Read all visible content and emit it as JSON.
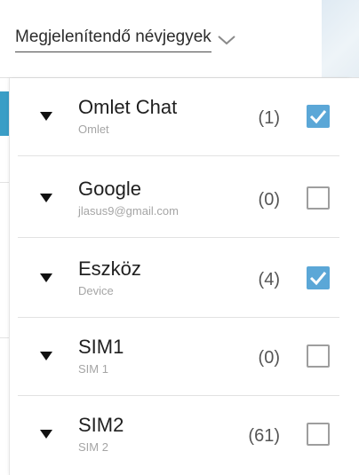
{
  "header": {
    "dropdown_label": "Megjelenítendő névjegyek"
  },
  "accounts": [
    {
      "name": "Omlet Chat",
      "subtitle": "Omlet",
      "count": "(1)",
      "checked": true
    },
    {
      "name": "Google",
      "subtitle": "jlasus9@gmail.com",
      "count": "(0)",
      "checked": false
    },
    {
      "name": "Eszköz",
      "subtitle": "Device",
      "count": "(4)",
      "checked": true
    },
    {
      "name": "SIM1",
      "subtitle": "SIM 1",
      "count": "(0)",
      "checked": false
    },
    {
      "name": "SIM2",
      "subtitle": "SIM 2",
      "count": "(61)",
      "checked": false
    }
  ],
  "colors": {
    "accent": "#3a9ec6",
    "checkbox_checked": "#5ba7d7"
  },
  "icons": {
    "dropdown": "chevron-down-icon",
    "expand": "expand-triangle-icon",
    "check": "check-icon"
  }
}
